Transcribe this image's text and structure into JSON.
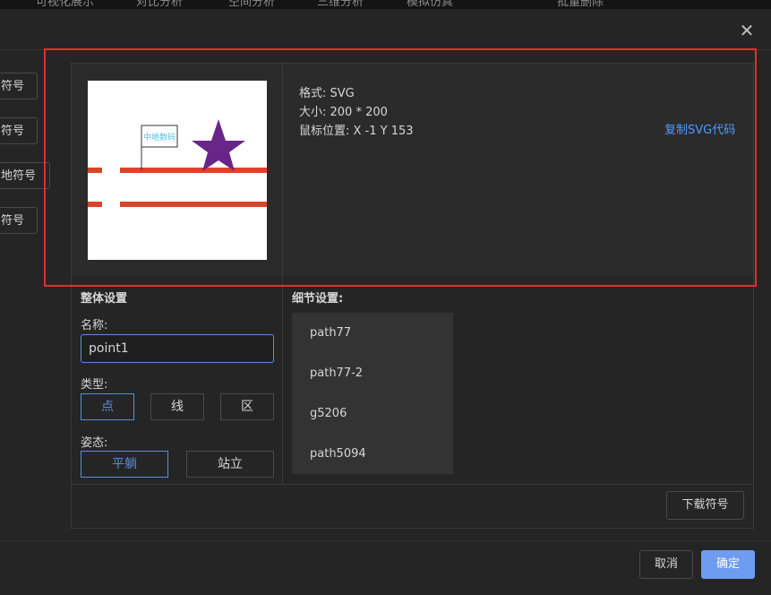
{
  "topbar": {
    "items": [
      "可视化展示",
      "对比分析",
      "空间分析",
      "三维分析",
      "模拟仿真",
      "批量删除"
    ]
  },
  "left_buttons": [
    "符号",
    "符号",
    "地符号",
    "符号"
  ],
  "preview": {
    "flag_text": "中地数码",
    "colors": {
      "line": "#d9452a",
      "star": "#6a2589",
      "canvas": "#ffffff"
    }
  },
  "info": {
    "format": "格式: SVG",
    "size": "大小: 200 * 200",
    "mouse": "鼠标位置: X -1 Y 153",
    "copy_link": "复制SVG代码"
  },
  "overall": {
    "title": "整体设置",
    "name_label": "名称:",
    "name_value": "point1",
    "type_label": "类型:",
    "types": [
      "点",
      "线",
      "区"
    ],
    "type_selected": "点",
    "pose_label": "姿态:",
    "poses": [
      "平躺",
      "站立"
    ],
    "pose_selected": "平躺"
  },
  "details": {
    "title": "细节设置:",
    "items": [
      "path77",
      "path77-2",
      "g5206",
      "path5094"
    ]
  },
  "buttons": {
    "download": "下载符号",
    "cancel": "取消",
    "confirm": "确定"
  },
  "colors": {
    "accent": "#5b8fd6",
    "primary": "#6e9cf0",
    "highlight_border": "#e0302a",
    "link": "#4f9bff"
  }
}
